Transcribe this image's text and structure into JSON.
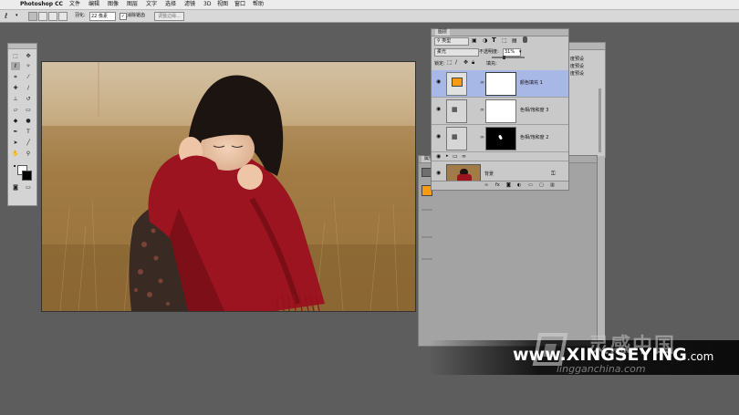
{
  "menubar": {
    "app_name": "Photoshop CC",
    "items": [
      "文件",
      "编辑",
      "图像",
      "图层",
      "文字",
      "选择",
      "滤镜",
      "3D",
      "视图",
      "窗口",
      "帮助"
    ]
  },
  "options": {
    "feather_label": "羽化:",
    "feather_value": "22 像素",
    "antialias_label": "消除锯齿",
    "refine_button": "调整边缘..."
  },
  "layers_panel": {
    "tab": "图层",
    "kind_filter": "类型",
    "blend_mode": "柔光",
    "opacity_label": "不透明度:",
    "opacity_value": "31%",
    "lock_label": "锁定:",
    "fill_label": "填充:",
    "layers": [
      {
        "name": "颜色填充 1",
        "selected": true
      },
      {
        "name": "色相/饱和度 3",
        "selected": false
      },
      {
        "name": "色相/饱和度 2",
        "selected": false
      },
      {
        "name": "",
        "selected": false
      },
      {
        "name": "背景",
        "selected": false
      }
    ]
  },
  "properties_panel": {
    "tab": "属性"
  },
  "right_panel": {
    "items": [
      "度预设",
      "度预设",
      "度预设"
    ]
  },
  "watermark": {
    "main": "www.XINGSEYING",
    "suffix": ".com",
    "sub": "lingganchina.com",
    "brand": "灵感中国"
  },
  "colors": {
    "layer_selected": "#a7b7e6",
    "fill_swatch": "#f59b14",
    "scarf": "#9b1420"
  }
}
